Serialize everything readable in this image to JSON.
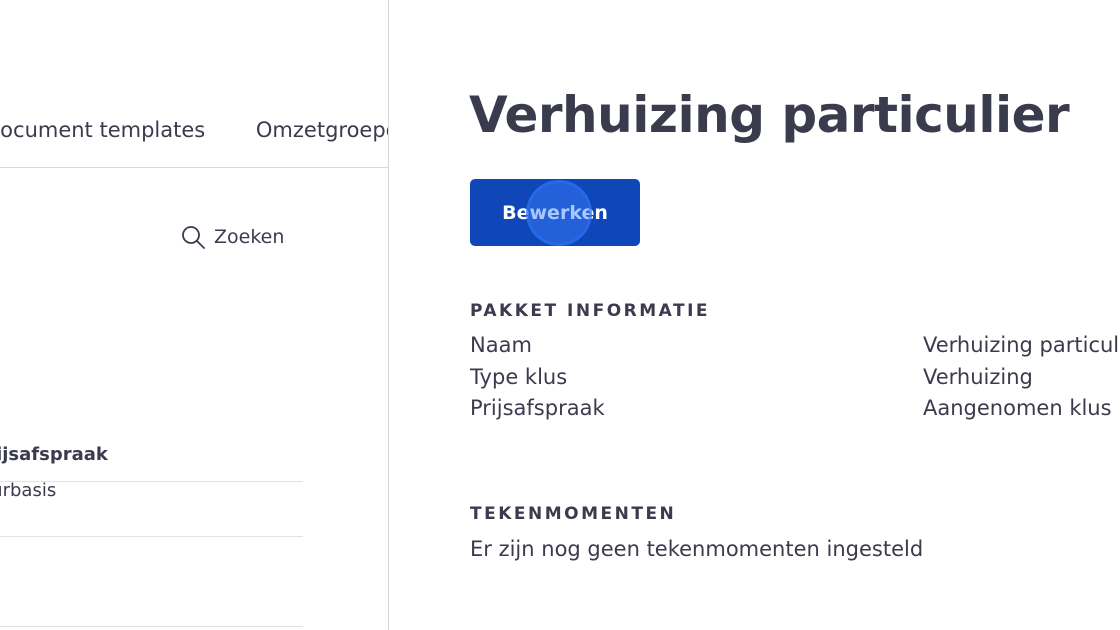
{
  "background_page": {
    "tabs": [
      "Document templates",
      "Omzetgroepen"
    ],
    "search": {
      "label": "Zoeken",
      "icon": "search-icon"
    },
    "table": {
      "column_header": "Prijsafspraak",
      "rows": [
        "Uurbasis"
      ]
    }
  },
  "detail_panel": {
    "title": "Verhuizing particulier",
    "edit_button_label": "Bewerken",
    "package_info": {
      "heading": "PAKKET INFORMATIE",
      "rows": [
        {
          "label": "Naam",
          "value": "Verhuizing particulier"
        },
        {
          "label": "Type klus",
          "value": "Verhuizing"
        },
        {
          "label": "Prijsafspraak",
          "value": "Aangenomen klus"
        }
      ]
    },
    "signing_moments": {
      "heading": "TEKENMOMENTEN",
      "empty_text": "Er zijn nog geen tekenmomenten ingesteld"
    }
  },
  "colors": {
    "text": "#3a3b4d",
    "primary_button": "#0f46b8",
    "click_indicator": "#3d83ff",
    "divider": "#d9dade"
  }
}
